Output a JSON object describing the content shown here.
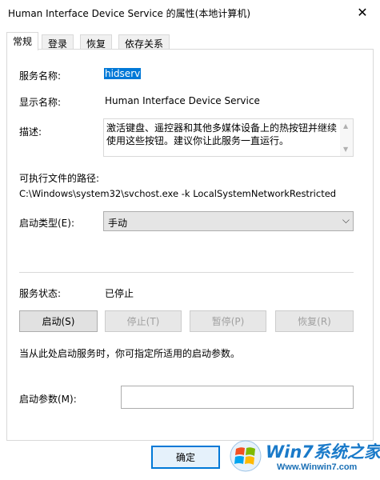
{
  "window": {
    "title": "Human Interface Device Service 的属性(本地计算机)"
  },
  "tabs": [
    {
      "label": "常规"
    },
    {
      "label": "登录"
    },
    {
      "label": "恢复"
    },
    {
      "label": "依存关系"
    }
  ],
  "general": {
    "service_name_label": "服务名称:",
    "service_name_value": "hidserv",
    "display_name_label": "显示名称:",
    "display_name_value": "Human Interface Device Service",
    "description_label": "描述:",
    "description_line1": "激活键盘、遥控器和其他多媒体设备上的热按钮并继续",
    "description_line2": "使用这些按钮。建议你让此服务一直运行。",
    "path_label": "可执行文件的路径:",
    "path_value": "C:\\Windows\\system32\\svchost.exe -k LocalSystemNetworkRestricted",
    "startup_type_label": "启动类型(E):",
    "startup_type_value": "手动",
    "status_label": "服务状态:",
    "status_value": "已停止",
    "buttons": {
      "start": "启动(S)",
      "stop": "停止(T)",
      "pause": "暂停(P)",
      "resume": "恢复(R)"
    },
    "hint": "当从此处启动服务时，你可指定所适用的启动参数。",
    "start_params_label": "启动参数(M):",
    "start_params_value": ""
  },
  "footer": {
    "ok_label": "确定"
  },
  "watermark": {
    "name": "Win7系统之家",
    "url": "Www.Winwin7.com"
  },
  "colors": {
    "selection": "#0078d7",
    "ok_border": "#0078d7",
    "watermark": "#1a7ac9"
  }
}
